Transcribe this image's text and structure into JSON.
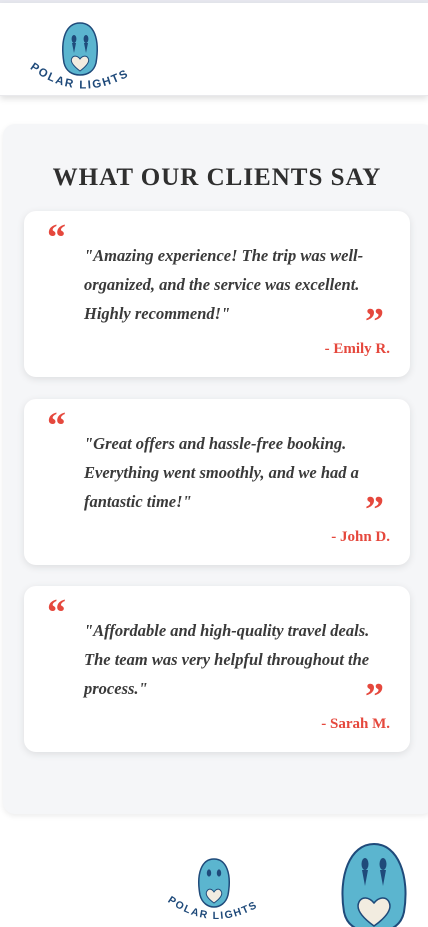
{
  "brand": {
    "name": "POLAR LIGHTS",
    "colors": {
      "logo_fill": "#5bb5cf",
      "logo_dark": "#1f4a7a",
      "heart": "#f2ece0",
      "accent_red": "#e5483d"
    },
    "icon": "penguin-heart-logo"
  },
  "testimonials": {
    "title": "WHAT OUR CLIENTS SAY",
    "open_mark": "“",
    "close_mark": "”",
    "items": [
      {
        "quote": "\"Amazing experience! The trip was well-organized, and the service was excellent. Highly recommend!\"",
        "author": "- Emily R."
      },
      {
        "quote": "\"Great offers and hassle-free booking. Everything went smoothly, and we had a fantastic time!\"",
        "author": "- John D."
      },
      {
        "quote": "\"Affordable and high-quality travel deals. The team was very helpful throughout the process.\"",
        "author": "- Sarah M."
      }
    ]
  }
}
